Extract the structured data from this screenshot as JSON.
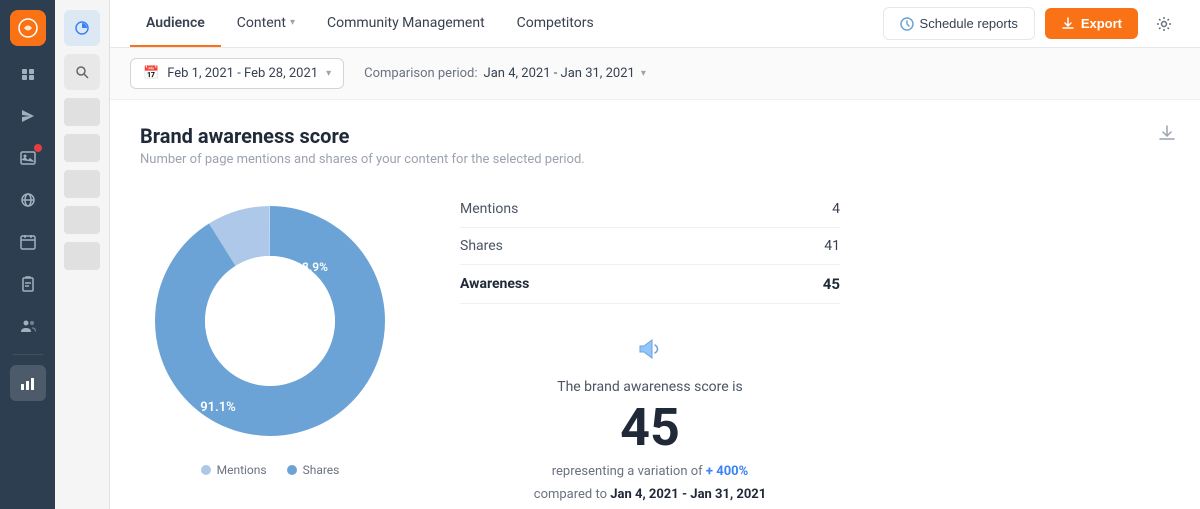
{
  "sidebar": {
    "logo": "HS",
    "icons": [
      {
        "name": "grid-icon",
        "symbol": "⊞",
        "active": false
      },
      {
        "name": "paper-plane-icon",
        "symbol": "➤",
        "active": false
      },
      {
        "name": "image-icon",
        "symbol": "🖼",
        "active": false,
        "badge": true
      },
      {
        "name": "globe-icon",
        "symbol": "🌐",
        "active": false
      },
      {
        "name": "calendar-icon",
        "symbol": "📅",
        "active": false
      },
      {
        "name": "clipboard-icon",
        "symbol": "📋",
        "active": false
      },
      {
        "name": "people-icon",
        "symbol": "👥",
        "active": false
      },
      {
        "name": "chart-icon",
        "symbol": "📊",
        "active": true
      }
    ]
  },
  "nav": {
    "tabs": [
      {
        "label": "Audience",
        "active": true,
        "hasChevron": false
      },
      {
        "label": "Content",
        "active": false,
        "hasChevron": true
      },
      {
        "label": "Community Management",
        "active": false,
        "hasChevron": false
      },
      {
        "label": "Competitors",
        "active": false,
        "hasChevron": false
      }
    ],
    "schedule_button": "Schedule reports",
    "export_button": "Export"
  },
  "datebar": {
    "date_range": "Feb 1, 2021 - Feb 28, 2021",
    "comparison_label": "Comparison period:",
    "comparison_range": "Jan 4, 2021 - Jan 31, 2021"
  },
  "chart": {
    "title": "Brand awareness score",
    "subtitle": "Number of page mentions and shares of your content for the selected period.",
    "donut": {
      "shares_pct": 91.1,
      "mentions_pct": 8.9,
      "shares_label": "91.1%",
      "mentions_label": "8.9%",
      "shares_color": "#6ba3d6",
      "mentions_color": "#adc8e8"
    },
    "legend": {
      "mentions_label": "Mentions",
      "shares_label": "Shares",
      "mentions_color": "#adc8e8",
      "shares_color": "#6ba3d6"
    },
    "stats": [
      {
        "label": "Mentions",
        "value": "4",
        "bold": false
      },
      {
        "label": "Shares",
        "value": "41",
        "bold": false
      },
      {
        "label": "Awareness",
        "value": "45",
        "bold": true
      }
    ],
    "awareness": {
      "label": "The brand awareness score is",
      "score": "45",
      "variation_prefix": "representing a variation of",
      "variation_value": "+ 400%",
      "comparison_prefix": "compared to",
      "comparison_period": "Jan 4, 2021 - Jan 31, 2021"
    }
  }
}
